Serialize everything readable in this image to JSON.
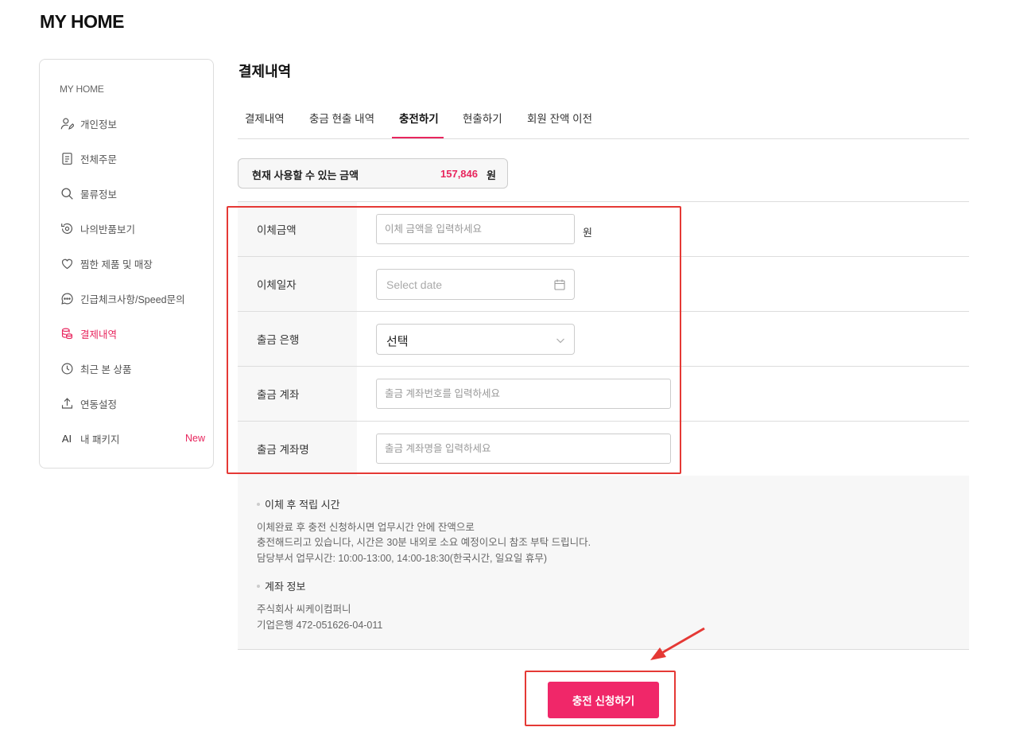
{
  "header": {
    "title": "MY HOME"
  },
  "sidebar": {
    "title": "MY HOME",
    "items": [
      {
        "label": "개인정보",
        "icon": "user-edit-icon"
      },
      {
        "label": "전체주문",
        "icon": "document-icon"
      },
      {
        "label": "물류정보",
        "icon": "search-icon"
      },
      {
        "label": "나의반품보기",
        "icon": "return-icon"
      },
      {
        "label": "찜한 제품 및 매장",
        "icon": "heart-icon"
      },
      {
        "label": "긴급체크사항/Speed문의",
        "icon": "chat-icon"
      },
      {
        "label": "결제내역",
        "icon": "coins-icon",
        "active": true
      },
      {
        "label": "최근 본 상품",
        "icon": "clock-icon"
      },
      {
        "label": "연동설정",
        "icon": "upload-icon"
      },
      {
        "label": "내 패키지",
        "icon": "ai-icon",
        "icon_text": "AI",
        "badge": "New"
      }
    ]
  },
  "main": {
    "title": "결제내역",
    "tabs": [
      {
        "label": "결제내역"
      },
      {
        "label": "충금 현출 내역"
      },
      {
        "label": "충전하기",
        "active": true
      },
      {
        "label": "현출하기"
      },
      {
        "label": "회원 잔액 이전"
      }
    ],
    "balance": {
      "label": "현재 사용할 수 있는 금액",
      "amount": "157,846",
      "unit": "원"
    },
    "form": {
      "amount": {
        "label": "이체금액",
        "placeholder": "이체 금액을 입력하세요",
        "unit": "원"
      },
      "date": {
        "label": "이체일자",
        "placeholder": "Select date"
      },
      "bank": {
        "label": "출금 은행",
        "selected": "선택"
      },
      "account": {
        "label": "출금 계좌",
        "placeholder": "출금 계좌번호를 입력하세요"
      },
      "account_name": {
        "label": "출금 계좌명",
        "placeholder": "출금 계좌명을 입력하세요"
      }
    },
    "info": {
      "time_title": "이체 후 적립 시간",
      "time_lines": [
        "이체완료 후 충전 신청하시면 업무시간 안에 잔액으로",
        "충전해드리고 있습니다, 시간은 30분 내외로 소요 예정이오니 참조 부탁 드립니다.",
        "담당부서 업무시간: 10:00-13:00, 14:00-18:30(한국시간, 일요일 휴무)"
      ],
      "account_title": "계좌 정보",
      "account_lines": [
        "주식회사 씨케이컴퍼니",
        "기업은행 472-051626-04-011"
      ]
    },
    "submit_label": "충전 신청하기"
  },
  "colors": {
    "accent": "#e8265e",
    "button": "#f02769",
    "annotation": "#e53935"
  }
}
